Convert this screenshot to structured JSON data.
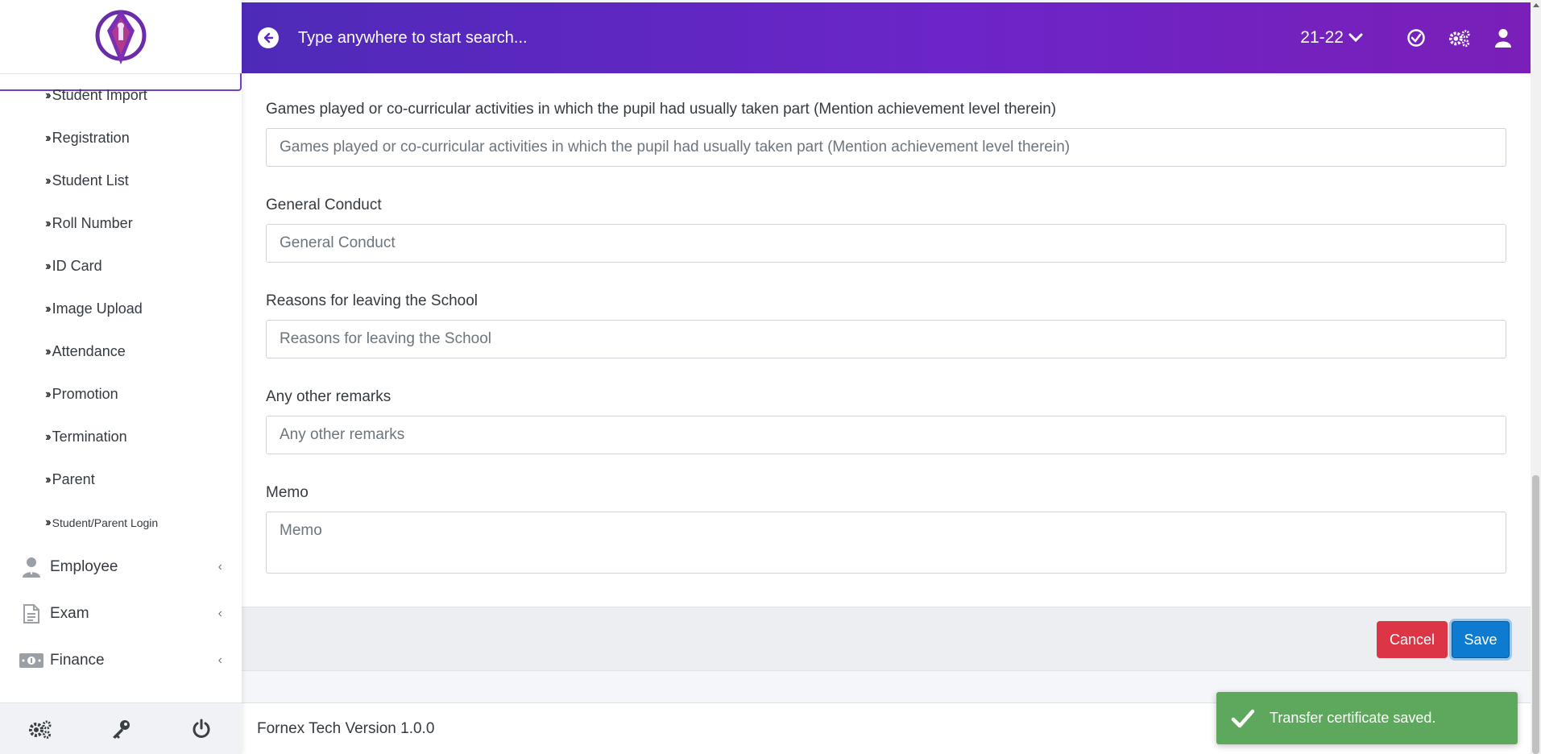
{
  "sidebar": {
    "sub_items": [
      {
        "label": "Student Import",
        "icon": "double-chevron-right-icon"
      },
      {
        "label": "Registration",
        "icon": "double-chevron-right-icon"
      },
      {
        "label": "Student List",
        "icon": "double-chevron-right-icon"
      },
      {
        "label": "Roll Number",
        "icon": "double-chevron-right-icon"
      },
      {
        "label": "ID Card",
        "icon": "double-chevron-right-icon"
      },
      {
        "label": "Image Upload",
        "icon": "double-chevron-right-icon"
      },
      {
        "label": "Attendance",
        "icon": "double-chevron-right-icon"
      },
      {
        "label": "Promotion",
        "icon": "double-chevron-right-icon"
      },
      {
        "label": "Termination",
        "icon": "double-chevron-right-icon"
      },
      {
        "label": "Parent",
        "icon": "double-chevron-right-icon"
      },
      {
        "label": "Student/Parent Login",
        "icon": "double-chevron-right-icon"
      }
    ],
    "main_items": [
      {
        "label": "Employee",
        "icon": "employee-icon"
      },
      {
        "label": "Exam",
        "icon": "document-icon"
      },
      {
        "label": "Finance",
        "icon": "money-icon"
      }
    ],
    "footer_icons": [
      "settings-icon",
      "key-icon",
      "power-icon"
    ]
  },
  "header": {
    "search_placeholder": "Type anywhere to start search...",
    "session": "21-22"
  },
  "form": {
    "games": {
      "label": "Games played or co-curricular activities in which the pupil had usually taken part (Mention achievement level therein)",
      "placeholder": "Games played or co-curricular activities in which the pupil had usually taken part (Mention achievement level therein)"
    },
    "conduct": {
      "label": "General Conduct",
      "placeholder": "General Conduct"
    },
    "reasons": {
      "label": "Reasons for leaving the School",
      "placeholder": "Reasons for leaving the School"
    },
    "remarks": {
      "label": "Any other remarks",
      "placeholder": "Any other remarks"
    },
    "memo": {
      "label": "Memo",
      "placeholder": "Memo"
    }
  },
  "actions": {
    "cancel": "Cancel",
    "save": "Save"
  },
  "footer": {
    "version": "Fornex Tech Version 1.0.0"
  },
  "toast": {
    "message": "Transfer certificate saved."
  },
  "colors": {
    "header_start": "#4e2ab8",
    "header_end": "#7a1fb8",
    "cancel": "#dc3545",
    "save": "#0d7bcf",
    "toast": "#5da85d"
  }
}
